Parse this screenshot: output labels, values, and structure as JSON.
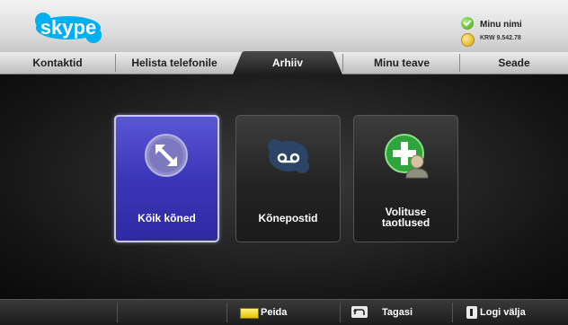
{
  "header": {
    "logo_text": "skype",
    "user_name": "Minu nimi",
    "user_credit": "KRW 9.542.78"
  },
  "nav": {
    "tabs": [
      {
        "label": "Kontaktid"
      },
      {
        "label": "Helista telefonile"
      },
      {
        "label": "Arhiiv",
        "active": true
      },
      {
        "label": "Minu teave"
      },
      {
        "label": "Seade"
      }
    ]
  },
  "main": {
    "tiles": [
      {
        "label": "Kõik kõned",
        "icon": "expand-arrows-icon",
        "selected": true
      },
      {
        "label": "Kõnepostid",
        "icon": "voicemail-icon"
      },
      {
        "label_line1": "Volituse",
        "label_line2": "taotlused",
        "icon": "add-contact-icon"
      }
    ]
  },
  "bottom": {
    "hide_label": "Peida",
    "back_label": "Tagasi",
    "logout_label": "Logi välja"
  },
  "colors": {
    "selected_tile": "#3a36b8",
    "skype_blue": "#00aff0",
    "hide_key": "#f1d800"
  }
}
